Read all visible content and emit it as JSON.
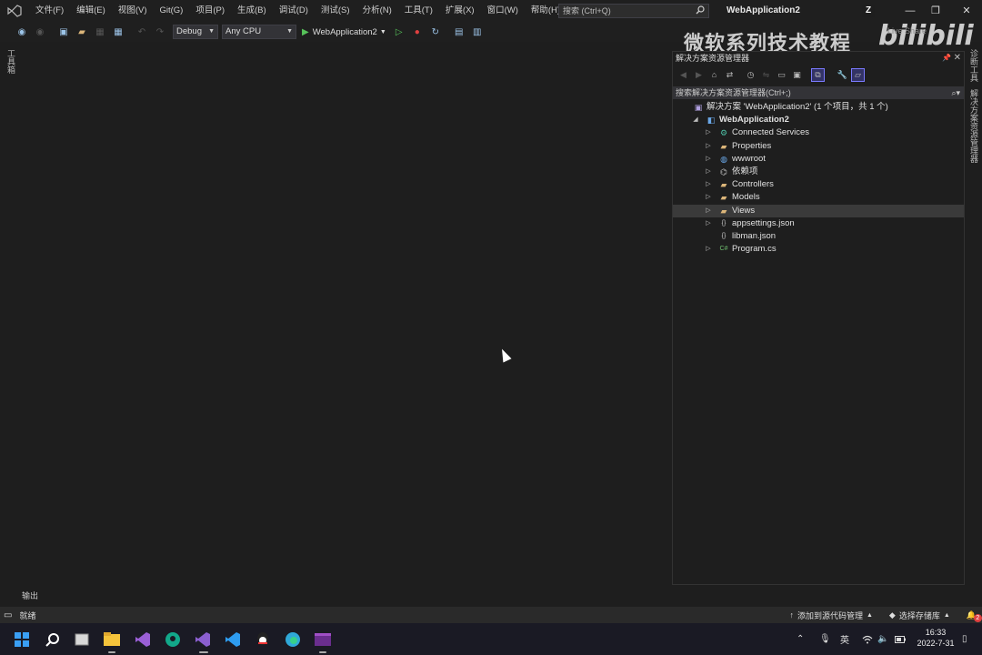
{
  "menubar": {
    "items": [
      "文件(F)",
      "编辑(E)",
      "视图(V)",
      "Git(G)",
      "项目(P)",
      "生成(B)",
      "调试(D)",
      "测试(S)",
      "分析(N)",
      "工具(T)",
      "扩展(X)",
      "窗口(W)",
      "帮助(H)"
    ],
    "search_placeholder": "搜索 (Ctrl+Q)",
    "window_title": "WebApplication2",
    "avatar_initial": "Z"
  },
  "toolbar": {
    "config": "Debug",
    "platform": "Any CPU",
    "run_target": "WebApplication2"
  },
  "watermark": {
    "text": "微软系列技术教程",
    "brand": "bilibili",
    "live_share": "Live Share"
  },
  "left_strip": {
    "label": "工具箱"
  },
  "right_strip": {
    "label_top": "诊断工具",
    "label_bottom": "解决方案资源管理器"
  },
  "solution_explorer": {
    "title": "解决方案资源管理器",
    "search_placeholder": "搜索解决方案资源管理器(Ctrl+;)",
    "tree": [
      {
        "label": "解决方案 'WebApplication2' (1 个项目，共 1 个)",
        "icon": "solution-icon",
        "depth": 0,
        "expander": "",
        "bold": false
      },
      {
        "label": "WebApplication2",
        "icon": "project-icon",
        "depth": 1,
        "expander": "◢",
        "bold": true
      },
      {
        "label": "Connected Services",
        "icon": "connected-services-icon",
        "depth": 2,
        "expander": "▷",
        "bold": false
      },
      {
        "label": "Properties",
        "icon": "wrench-folder-icon",
        "depth": 2,
        "expander": "▷",
        "bold": false
      },
      {
        "label": "wwwroot",
        "icon": "globe-icon",
        "depth": 2,
        "expander": "▷",
        "bold": false
      },
      {
        "label": "依赖项",
        "icon": "dependencies-icon",
        "depth": 2,
        "expander": "▷",
        "bold": false
      },
      {
        "label": "Controllers",
        "icon": "folder-icon",
        "depth": 2,
        "expander": "▷",
        "bold": false
      },
      {
        "label": "Models",
        "icon": "folder-icon",
        "depth": 2,
        "expander": "▷",
        "bold": false
      },
      {
        "label": "Views",
        "icon": "folder-icon",
        "depth": 2,
        "expander": "▷",
        "bold": false,
        "selected": true
      },
      {
        "label": "appsettings.json",
        "icon": "json-icon",
        "depth": 2,
        "expander": "▷",
        "bold": false
      },
      {
        "label": "libman.json",
        "icon": "json-icon",
        "depth": 2,
        "expander": "",
        "bold": false
      },
      {
        "label": "Program.cs",
        "icon": "csharp-icon",
        "depth": 2,
        "expander": "▷",
        "bold": false
      }
    ]
  },
  "output_tab": {
    "label": "输出"
  },
  "statusbar": {
    "ready": "就绪",
    "add_source_control": "添加到源代码管理",
    "select_repo": "选择存储库",
    "notification_count": "2"
  },
  "taskbar": {
    "ime": "英",
    "time": "16:33",
    "date": "2022-7-31"
  },
  "colors": {
    "editor_bg": "#1e1e1e",
    "selection": "#3a3a3a",
    "run_green": "#57c35a",
    "folder_yellow": "#dcb67a"
  }
}
